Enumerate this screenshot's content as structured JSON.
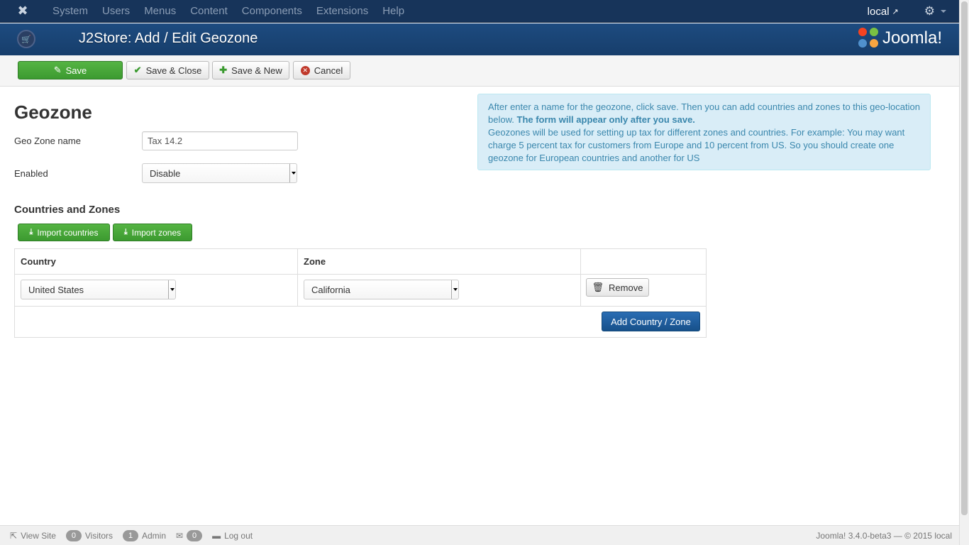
{
  "navbar": {
    "menu": [
      "System",
      "Users",
      "Menus",
      "Content",
      "Components",
      "Extensions",
      "Help"
    ],
    "site_link": "local"
  },
  "header": {
    "title": "J2Store: Add / Edit Geozone",
    "brand": "Joomla!"
  },
  "toolbar": {
    "save": "Save",
    "save_close": "Save & Close",
    "save_new": "Save & New",
    "cancel": "Cancel"
  },
  "form": {
    "title": "Geozone",
    "name_label": "Geo Zone name",
    "name_value": "Tax 14.2",
    "enabled_label": "Enabled",
    "enabled_value": "Disable"
  },
  "info": {
    "line1": "After enter a name for the geozone, click save. Then you can add countries and zones to this geo-location below.",
    "bold": "The form will appear only after you save.",
    "line2": "Geozones will be used for setting up tax for different zones and countries. For example: You may want charge 5 percent tax for customers from Europe and 10 percent from US. So you should create one geozone for European countries and another for US"
  },
  "countries": {
    "title": "Countries and Zones",
    "import_countries": "Import countries",
    "import_zones": "Import zones",
    "col_country": "Country",
    "col_zone": "Zone",
    "rows": [
      {
        "country": "United States",
        "zone": "California"
      }
    ],
    "remove": "Remove",
    "add": "Add Country / Zone"
  },
  "status": {
    "view_site": "View Site",
    "visitors_count": "0",
    "visitors": "Visitors",
    "admin_count": "1",
    "admin": "Admin",
    "messages_count": "0",
    "logout": "Log out",
    "version": "Joomla! 3.4.0-beta3 — © 2015 local"
  },
  "colors": {
    "navbar": "#17345a",
    "header": "#1d4b80",
    "save_green": "#4aa83a",
    "info_bg": "#d9edf7",
    "primary_blue": "#1f5e9e"
  }
}
